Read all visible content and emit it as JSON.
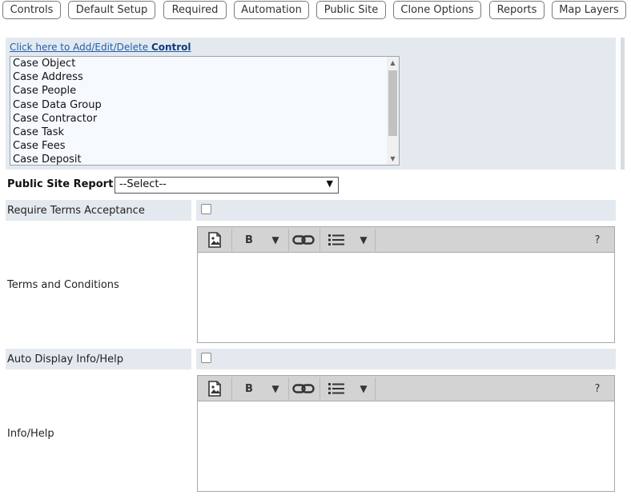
{
  "tabs": [
    {
      "label": "Controls"
    },
    {
      "label": "Default Setup"
    },
    {
      "label": "Required"
    },
    {
      "label": "Automation"
    },
    {
      "label": "Public Site"
    },
    {
      "label": "Clone Options"
    },
    {
      "label": "Reports"
    },
    {
      "label": "Map Layers"
    }
  ],
  "control_panel": {
    "link_prefix": "Click here to Add/Edit/Delete ",
    "link_bold": "Control",
    "items": [
      "Case Object",
      "Case Address",
      "Case People",
      "Case Data Group",
      "Case Contractor",
      "Case Task",
      "Case Fees",
      "Case Deposit"
    ]
  },
  "public_site_report": {
    "label": "Public Site Report",
    "selected": "--Select--"
  },
  "require_terms": {
    "label": "Require Terms Acceptance",
    "checked": false
  },
  "terms_and_conditions": {
    "label": "Terms and Conditions",
    "value": ""
  },
  "auto_display": {
    "label": "Auto Display Info/Help",
    "checked": false
  },
  "info_help": {
    "label": "Info/Help",
    "value": ""
  },
  "editor_toolbar": {
    "bold_label": "B",
    "help_label": "?",
    "caret": "▼",
    "icons": [
      "image-icon",
      "bold-icon",
      "link-icon",
      "list-icon",
      "help-icon"
    ]
  },
  "colors": {
    "panel_bg": "#e4e9f0",
    "link": "#1f5faa",
    "toolbar_bg": "#d3d3d3"
  }
}
